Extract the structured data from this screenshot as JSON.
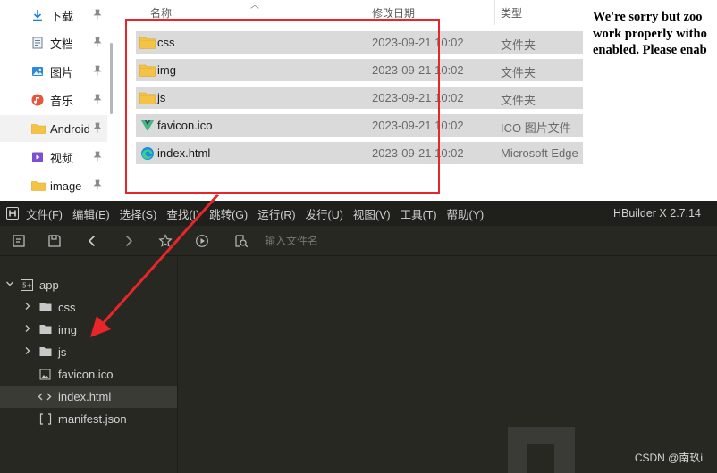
{
  "explorer": {
    "quick_access": [
      {
        "label": "下载",
        "icon": "download-icon"
      },
      {
        "label": "文档",
        "icon": "document-icon"
      },
      {
        "label": "图片",
        "icon": "pictures-icon"
      },
      {
        "label": "音乐",
        "icon": "music-icon"
      },
      {
        "label": "Android",
        "icon": "folder-icon"
      },
      {
        "label": "视频",
        "icon": "video-icon"
      },
      {
        "label": "image",
        "icon": "folder-icon"
      }
    ],
    "pin_glyph": "📌",
    "columns": {
      "name": "名称",
      "date": "修改日期",
      "type": "类型"
    },
    "files": [
      {
        "name": "css",
        "date": "2023-09-21 10:02",
        "type": "文件夹",
        "icon": "folder-icon"
      },
      {
        "name": "img",
        "date": "2023-09-21 10:02",
        "type": "文件夹",
        "icon": "folder-icon"
      },
      {
        "name": "js",
        "date": "2023-09-21 10:02",
        "type": "文件夹",
        "icon": "folder-icon"
      },
      {
        "name": "favicon.ico",
        "date": "2023-09-21 10:02",
        "type": "ICO 图片文件",
        "icon": "vue-logo-icon"
      },
      {
        "name": "index.html",
        "date": "2023-09-21 10:02",
        "type": "Microsoft Edge",
        "icon": "edge-icon"
      }
    ]
  },
  "browser_message": {
    "line1": "We're sorry but zoo",
    "line2": "work properly witho",
    "line3": "enabled. Please enab"
  },
  "hbuilder": {
    "menu": [
      "文件(F)",
      "编辑(E)",
      "选择(S)",
      "查找(I)",
      "跳转(G)",
      "运行(R)",
      "发行(U)",
      "视图(V)",
      "工具(T)",
      "帮助(Y)"
    ],
    "version": "HBuilder X 2.7.14",
    "search_placeholder": "输入文件名",
    "tree": {
      "root": "app",
      "items": [
        {
          "label": "css",
          "kind": "folder"
        },
        {
          "label": "img",
          "kind": "folder"
        },
        {
          "label": "js",
          "kind": "folder"
        },
        {
          "label": "favicon.ico",
          "kind": "image"
        },
        {
          "label": "index.html",
          "kind": "html"
        },
        {
          "label": "manifest.json",
          "kind": "json"
        }
      ]
    },
    "watermark": "CSDN @南玖i"
  },
  "colors": {
    "annotation_red": "#e8262a",
    "folder_yellow": "#f5c343",
    "editor_bg": "#272822"
  }
}
